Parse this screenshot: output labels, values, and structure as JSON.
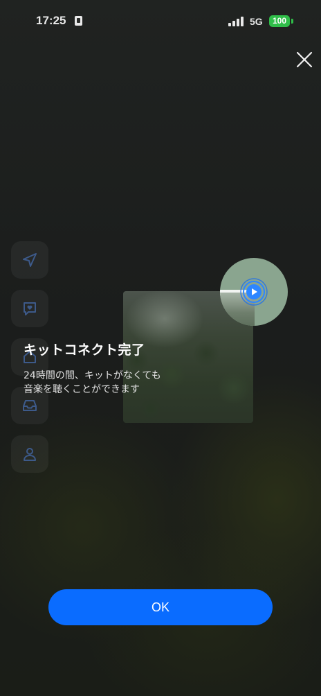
{
  "status_bar": {
    "time": "17:25",
    "network": "5G",
    "battery": "100"
  },
  "icons": {
    "close": "close-icon",
    "sidebar": [
      "send-icon",
      "chat-heart-icon",
      "home-icon",
      "inbox-icon",
      "user-icon"
    ],
    "disc_play": "play-icon"
  },
  "dialog": {
    "title": "キットコネクト完了",
    "description_line1": "24時間の間、キットがなくても",
    "description_line2": "音楽を聴くことができます"
  },
  "button": {
    "ok_label": "OK"
  },
  "colors": {
    "accent": "#0a6cff",
    "battery": "#2fbe49",
    "background": "#1b1d1b"
  }
}
